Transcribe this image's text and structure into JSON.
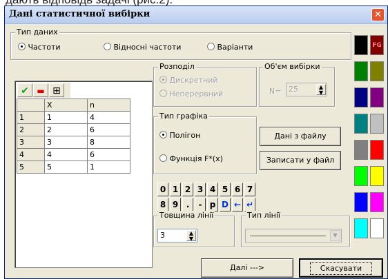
{
  "top_text": "дають відповідь задачі (рис.2).",
  "window": {
    "title": "Дані статистичної вибірки",
    "close_glyph": "✕"
  },
  "data_type": {
    "label": "Тип даних",
    "options": [
      "Частоти",
      "Відносні частоти",
      "Варіанти"
    ],
    "selected": "Частоти"
  },
  "toolbar": {
    "ok_glyph": "✔",
    "delete_glyph": "▬",
    "table_glyph": "⊞"
  },
  "table": {
    "headers": [
      "",
      "X",
      "n"
    ],
    "rows": [
      [
        "1",
        "1",
        "4"
      ],
      [
        "2",
        "2",
        "6"
      ],
      [
        "3",
        "3",
        "8"
      ],
      [
        "4",
        "4",
        "6"
      ],
      [
        "5",
        "5",
        "1"
      ]
    ]
  },
  "distribution": {
    "label": "Розподіл",
    "options": [
      "Дискретний",
      "Неперервний"
    ],
    "selected": "Дискретний"
  },
  "sample_size": {
    "label": "Об'єм вибірки",
    "prefix": "N=",
    "value": "25"
  },
  "graph_type": {
    "label": "Тип графіка",
    "options": [
      "Полігон",
      "Функція F*(x)"
    ],
    "selected": "Полігон"
  },
  "buttons": {
    "load_file": "Дані з файлу",
    "save_file": "Записати у файл",
    "next": "Далі --->",
    "cancel": "Скасувати"
  },
  "keypad": {
    "row1": [
      "0",
      "1",
      "2",
      "3",
      "4",
      "5",
      "6",
      "7"
    ],
    "row2": [
      "8",
      "9",
      ".",
      "-",
      "p",
      "D",
      "←",
      "↵"
    ]
  },
  "line_width": {
    "label": "Товщина лінії",
    "value": "3"
  },
  "line_type": {
    "label": "Тип лінії"
  },
  "palette": {
    "fg_label": "FG",
    "colors": [
      [
        "#000000",
        "#800000"
      ],
      [
        "#008000",
        "#808000"
      ],
      [
        "#000080",
        "#800080"
      ],
      [
        "#008080",
        "#c0c0c0"
      ],
      [
        "#808080",
        "#ff0000"
      ],
      [
        "#00ff00",
        "#ffff00"
      ],
      [
        "#0000ff",
        "#ff00ff"
      ],
      [
        "#00ffff",
        "#ffffff"
      ]
    ]
  }
}
